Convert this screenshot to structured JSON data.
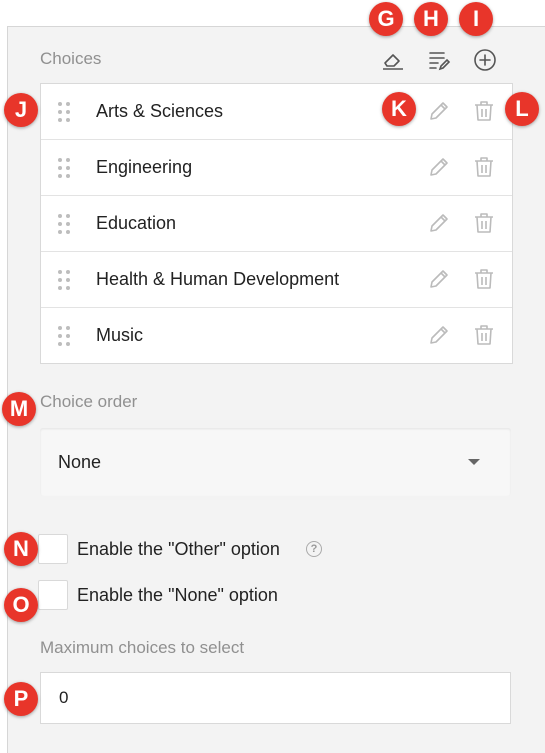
{
  "choices": {
    "label": "Choices",
    "items": [
      {
        "text": "Arts & Sciences"
      },
      {
        "text": "Engineering"
      },
      {
        "text": "Education"
      },
      {
        "text": "Health & Human Development"
      },
      {
        "text": "Music"
      }
    ]
  },
  "toolbar": {
    "clear_icon": "eraser-icon",
    "edit_all_icon": "list-edit-icon",
    "add_icon": "plus-circle-icon"
  },
  "choice_order": {
    "label": "Choice order",
    "selected": "None"
  },
  "other_option": {
    "label": "Enable the \"Other\" option",
    "help": "?"
  },
  "none_option": {
    "label": "Enable the \"None\" option"
  },
  "max_choices": {
    "label": "Maximum choices to select",
    "value": "0"
  },
  "callouts": {
    "g": "G",
    "h": "H",
    "i": "I",
    "j": "J",
    "k": "K",
    "l": "L",
    "m": "M",
    "n": "N",
    "o": "O",
    "p": "P"
  },
  "colors": {
    "callout": "#e8352a",
    "panel_bg": "#f3f3f3",
    "label_gray": "#909090"
  }
}
